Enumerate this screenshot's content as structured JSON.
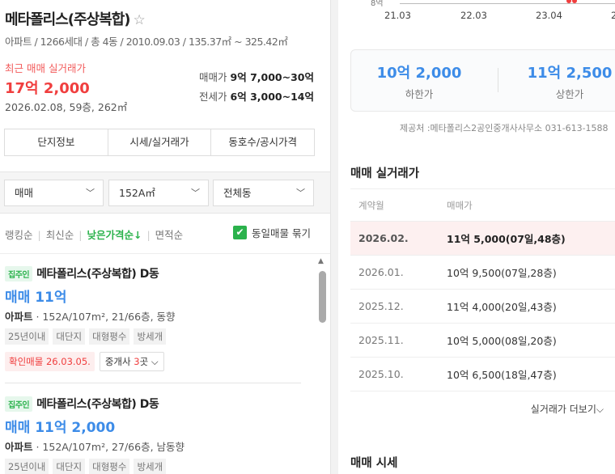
{
  "complex": {
    "title": "메타폴리스(주상복합)",
    "star_icon": "☆",
    "meta": "아파트 / 1266세대 / 총 4동 / 2010.09.03 / 135.37㎡ ~ 325.42㎡",
    "recent_label": "최근 매매 실거래가",
    "recent_price": "17억 2,000",
    "recent_sub": "2026.02.08, 59층, 262㎡",
    "sale_label": "매매가",
    "sale_range": "9억 7,000~30억",
    "jeonse_label": "전세가",
    "jeonse_range": "6억 3,000~14억"
  },
  "tabs": [
    "단지정보",
    "시세/실거래가",
    "동호수/공시가격"
  ],
  "filters": [
    "매매",
    "152A㎡",
    "전체동"
  ],
  "sort": {
    "items": [
      "랭킹순",
      "최신순",
      "낮은가격순↓",
      "면적순"
    ],
    "active": 2,
    "bundle_label": "동일매물 묶기",
    "bundle_checked": true
  },
  "listings": [
    {
      "badge": "집주인",
      "name": "메타폴리스(주상복합) D동",
      "price": "매매 11억",
      "type": "아파트",
      "desc": " · 152A/107m², 21/66층, 동향",
      "tags": [
        "25년이내",
        "대단지",
        "대형평수",
        "방세개"
      ],
      "confirmed": "확인매물 26.03.05.",
      "agent_prefix": "중개사 ",
      "agent_count": "3",
      "agent_suffix": "곳 ⌵"
    },
    {
      "badge": "집주인",
      "name": "메타폴리스(주상복합) D동",
      "price": "매매 11억 2,000",
      "type": "아파트",
      "desc": " · 152A/107m², 27/66층, 남동향",
      "tags": [
        "25년이내",
        "대단지",
        "대형평수",
        "방세개"
      ]
    }
  ],
  "chart_data": {
    "type": "scatter",
    "y_label_visible": "8억",
    "x_ticks": [
      "21.03",
      "22.03",
      "23.04",
      "2"
    ]
  },
  "price_range": {
    "low": "10억 2,000",
    "low_label": "하한가",
    "high": "11억 2,500",
    "high_label": "상한가"
  },
  "provider": "제공처 :메타폴리스2공인중개사사무소 031-613-1588",
  "deals": {
    "title": "매매 실거래가",
    "headers": [
      "계약월",
      "매매가"
    ],
    "rows": [
      [
        "2026.02.",
        "11억 5,000(07일,48층)"
      ],
      [
        "2026.01.",
        "10억 9,500(07일,28층)"
      ],
      [
        "2025.12.",
        "11억 4,000(20일,43층)"
      ],
      [
        "2025.11.",
        "10억 5,000(08일,20층)"
      ],
      [
        "2025.10.",
        "10억 6,500(18일,47층)"
      ]
    ],
    "more": "실거래가 더보기⌵"
  },
  "market_title": "매매 시세",
  "colors": {
    "accent_blue": "#3d8ce8",
    "accent_red": "#f03e3e",
    "accent_green": "#2bb24c"
  }
}
